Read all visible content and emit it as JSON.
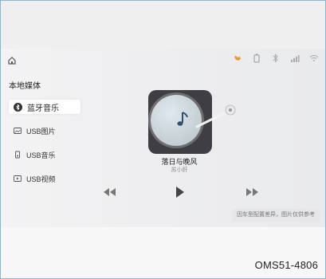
{
  "section_title": "本地媒体",
  "menu": {
    "items": [
      {
        "label": "蓝牙音乐",
        "icon": "bluetooth-icon"
      },
      {
        "label": "USB图片",
        "icon": "image-icon"
      },
      {
        "label": "USB音乐",
        "icon": "music-file-icon"
      },
      {
        "label": "USB视频",
        "icon": "video-icon"
      }
    ],
    "active_index": 0
  },
  "now_playing": {
    "title": "落日与晚风",
    "artist": "苏小肝"
  },
  "controls": {
    "prev_icon": "rewind-icon",
    "play_icon": "play-icon",
    "next_icon": "fast-forward-icon"
  },
  "status_icons": [
    "pet-icon",
    "battery-icon",
    "bluetooth-icon",
    "signal-icon",
    "wifi-icon"
  ],
  "disclaimer": "因车型配置差异，图片仅供参考",
  "figure_code": "OMS51-4806",
  "colors": {
    "accent_dog": "#e59a3a",
    "album_bg": "#3f3f43",
    "frame_border": "#8fb3c9"
  }
}
